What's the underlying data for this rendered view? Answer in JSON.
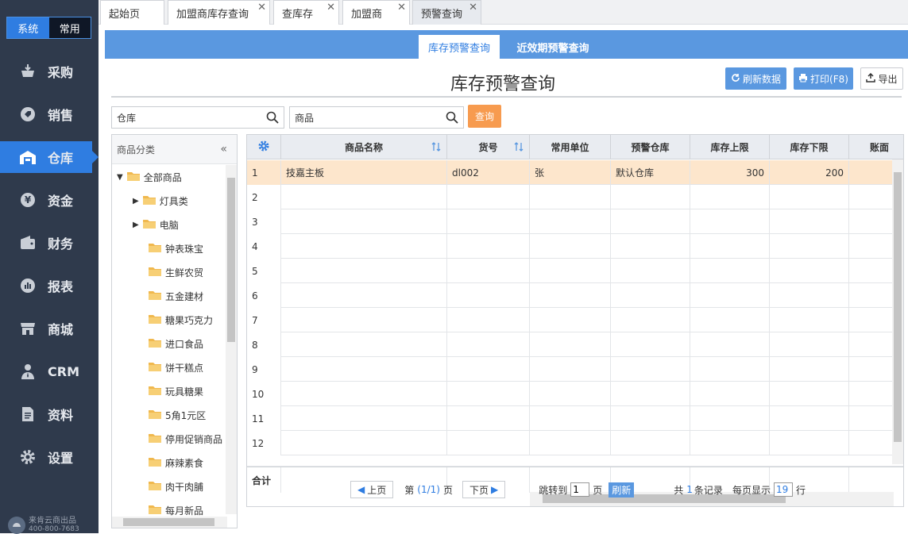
{
  "sidebar": {
    "mode_system": "系统",
    "mode_common": "常用",
    "items": [
      {
        "label": "采购",
        "icon": "purchase-icon"
      },
      {
        "label": "销售",
        "icon": "sales-tag-icon"
      },
      {
        "label": "仓库",
        "icon": "warehouse-icon"
      },
      {
        "label": "资金",
        "icon": "yuan-icon"
      },
      {
        "label": "财务",
        "icon": "wallet-icon"
      },
      {
        "label": "报表",
        "icon": "report-chart-icon"
      },
      {
        "label": "商城",
        "icon": "store-icon"
      },
      {
        "label": "CRM",
        "icon": "crm-person-icon"
      },
      {
        "label": "资料",
        "icon": "document-icon"
      },
      {
        "label": "设置",
        "icon": "gear-icon"
      }
    ],
    "active_index": 2,
    "brand": "来肯云商出品",
    "brand_phone": "400-800-7683"
  },
  "tabs": [
    {
      "label": "起始页",
      "closable": false
    },
    {
      "label": "加盟商库存查询",
      "closable": true
    },
    {
      "label": "查库存",
      "closable": true
    },
    {
      "label": "加盟商",
      "closable": true
    },
    {
      "label": "预警查询",
      "closable": true,
      "active": true
    }
  ],
  "subtabs": [
    {
      "label": "库存预警查询",
      "active": true
    },
    {
      "label": "近效期预警查询",
      "active": false
    }
  ],
  "page_title": "库存预警查询",
  "toolbar": {
    "refresh_label": "刷新数据",
    "print_label": "打印(F8)",
    "export_label": "导出"
  },
  "filters": {
    "warehouse_value": "仓库",
    "product_value": "商品",
    "query_label": "查询"
  },
  "tree": {
    "header": "商品分类",
    "root": "全部商品",
    "nodes": [
      {
        "label": "灯具类",
        "expandable": true
      },
      {
        "label": "电脑",
        "expandable": true
      },
      {
        "label": "钟表珠宝",
        "expandable": false
      },
      {
        "label": "生鲜农贸",
        "expandable": false
      },
      {
        "label": "五金建材",
        "expandable": false
      },
      {
        "label": "糖果巧克力",
        "expandable": false
      },
      {
        "label": "进口食品",
        "expandable": false
      },
      {
        "label": "饼干糕点",
        "expandable": false
      },
      {
        "label": "玩具糖果",
        "expandable": false
      },
      {
        "label": "5角1元区",
        "expandable": false
      },
      {
        "label": "停用促销商品",
        "expandable": false
      },
      {
        "label": "麻辣素食",
        "expandable": false
      },
      {
        "label": "肉干肉脯",
        "expandable": false
      },
      {
        "label": "每月新品",
        "expandable": false
      }
    ]
  },
  "grid": {
    "columns": [
      "商品名称",
      "货号",
      "常用单位",
      "预警仓库",
      "库存上限",
      "库存下限",
      "账面"
    ],
    "rows": [
      {
        "index": "1",
        "name": "技嘉主板",
        "code": "dl002",
        "unit": "张",
        "warehouse": "默认仓库",
        "upper": "300",
        "lower": "200"
      },
      {
        "index": "2",
        "name": "",
        "code": "",
        "unit": "",
        "warehouse": "",
        "upper": "",
        "lower": ""
      },
      {
        "index": "3",
        "name": "",
        "code": "",
        "unit": "",
        "warehouse": "",
        "upper": "",
        "lower": ""
      },
      {
        "index": "4",
        "name": "",
        "code": "",
        "unit": "",
        "warehouse": "",
        "upper": "",
        "lower": ""
      },
      {
        "index": "5",
        "name": "",
        "code": "",
        "unit": "",
        "warehouse": "",
        "upper": "",
        "lower": ""
      },
      {
        "index": "6",
        "name": "",
        "code": "",
        "unit": "",
        "warehouse": "",
        "upper": "",
        "lower": ""
      },
      {
        "index": "7",
        "name": "",
        "code": "",
        "unit": "",
        "warehouse": "",
        "upper": "",
        "lower": ""
      },
      {
        "index": "8",
        "name": "",
        "code": "",
        "unit": "",
        "warehouse": "",
        "upper": "",
        "lower": ""
      },
      {
        "index": "9",
        "name": "",
        "code": "",
        "unit": "",
        "warehouse": "",
        "upper": "",
        "lower": ""
      },
      {
        "index": "10",
        "name": "",
        "code": "",
        "unit": "",
        "warehouse": "",
        "upper": "",
        "lower": ""
      },
      {
        "index": "11",
        "name": "",
        "code": "",
        "unit": "",
        "warehouse": "",
        "upper": "",
        "lower": ""
      },
      {
        "index": "12",
        "name": "",
        "code": "",
        "unit": "",
        "warehouse": "",
        "upper": "",
        "lower": ""
      }
    ],
    "total_label": "合计"
  },
  "pager": {
    "prev_label": "上页",
    "page_prefix": "第",
    "page_current": "(1/1)",
    "page_suffix": "页",
    "next_label": "下页",
    "jump_prefix": "跳转到",
    "jump_value": "1",
    "jump_suffix": "页",
    "refresh_label": "刷新",
    "total_prefix": "共",
    "total_count": "1",
    "total_suffix": "条记录",
    "per_page_prefix": "每页显示",
    "per_page_value": "19",
    "per_page_suffix": "行"
  },
  "colors": {
    "sidebar_bg": "#2f3a4c",
    "accent": "#2f7de1",
    "header_blue": "#5a98e0",
    "query_orange": "#f79b4f",
    "row_highlight": "#fde6cc",
    "folder": "#f0b84e"
  }
}
